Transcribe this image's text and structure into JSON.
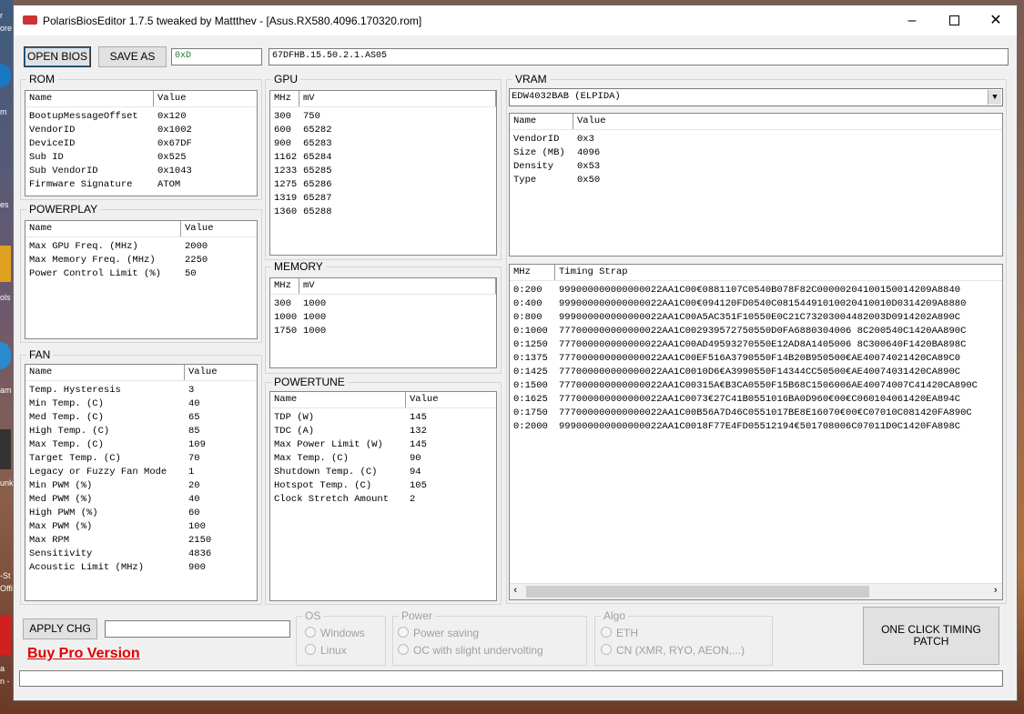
{
  "window": {
    "title": "PolarisBiosEditor 1.7.5 tweaked by Mattthev  - [Asus.RX580.4096.170320.rom]"
  },
  "toolbar": {
    "open_label": "OPEN BIOS",
    "save_label": "SAVE AS",
    "checksum": "0xD",
    "bios_string": "67DFHB.15.50.2.1.AS05"
  },
  "rom": {
    "title": "ROM",
    "headers": [
      "Name",
      "Value"
    ],
    "rows": [
      [
        "BootupMessageOffset",
        "0x120"
      ],
      [
        "VendorID",
        "0x1002"
      ],
      [
        "DeviceID",
        "0x67DF"
      ],
      [
        "Sub ID",
        "0x525"
      ],
      [
        "Sub VendorID",
        "0x1043"
      ],
      [
        "Firmware Signature",
        "ATOM"
      ]
    ]
  },
  "powerplay": {
    "title": "POWERPLAY",
    "headers": [
      "Name",
      "Value"
    ],
    "rows": [
      [
        "Max GPU Freq. (MHz)",
        "2000"
      ],
      [
        "Max Memory Freq. (MHz)",
        "2250"
      ],
      [
        "Power Control Limit (%)",
        "50"
      ]
    ]
  },
  "fan": {
    "title": "FAN",
    "headers": [
      "Name",
      "Value"
    ],
    "rows": [
      [
        "Temp. Hysteresis",
        "3"
      ],
      [
        "Min Temp. (C)",
        "40"
      ],
      [
        "Med Temp. (C)",
        "65"
      ],
      [
        "High Temp. (C)",
        "85"
      ],
      [
        "Max Temp. (C)",
        "109"
      ],
      [
        "Target Temp. (C)",
        "70"
      ],
      [
        "Legacy or Fuzzy Fan Mode",
        "1"
      ],
      [
        "Min PWM (%)",
        "20"
      ],
      [
        "Med PWM (%)",
        "40"
      ],
      [
        "High PWM (%)",
        "60"
      ],
      [
        "Max PWM (%)",
        "100"
      ],
      [
        "Max RPM",
        "2150"
      ],
      [
        "Sensitivity",
        "4836"
      ],
      [
        "Acoustic Limit (MHz)",
        "900"
      ]
    ]
  },
  "gpu": {
    "title": "GPU",
    "headers": [
      "MHz",
      "mV"
    ],
    "rows": [
      [
        "300",
        "750"
      ],
      [
        "600",
        "65282"
      ],
      [
        "900",
        "65283"
      ],
      [
        "1162",
        "65284"
      ],
      [
        "1233",
        "65285"
      ],
      [
        "1275",
        "65286"
      ],
      [
        "1319",
        "65287"
      ],
      [
        "1360",
        "65288"
      ]
    ]
  },
  "memory": {
    "title": "MEMORY",
    "headers": [
      "MHz",
      "mV"
    ],
    "rows": [
      [
        "300",
        "1000"
      ],
      [
        "1000",
        "1000"
      ],
      [
        "1750",
        "1000"
      ]
    ]
  },
  "powertune": {
    "title": "POWERTUNE",
    "headers": [
      "Name",
      "Value"
    ],
    "rows": [
      [
        "TDP (W)",
        "145"
      ],
      [
        "TDC (A)",
        "132"
      ],
      [
        "Max Power Limit (W)",
        "145"
      ],
      [
        "Max Temp. (C)",
        "90"
      ],
      [
        "Shutdown Temp. (C)",
        "94"
      ],
      [
        "Hotspot Temp. (C)",
        "105"
      ],
      [
        "Clock Stretch Amount",
        "2"
      ]
    ]
  },
  "vram": {
    "title": "VRAM",
    "selected": "EDW4032BAB (ELPIDA)",
    "headers": [
      "Name",
      "Value"
    ],
    "rows": [
      [
        "VendorID",
        "0x3"
      ],
      [
        "Size (MB)",
        "4096"
      ],
      [
        "Density",
        "0x53"
      ],
      [
        "Type",
        "0x50"
      ]
    ]
  },
  "timing": {
    "headers": [
      "MHz",
      "Timing Strap"
    ],
    "rows": [
      [
        "0:200",
        "999000000000000022AA1C00€0881107C0540B078F82C0000020410015001420‌9A8840"
      ],
      [
        "0:400",
        "999000000000000022AA1C00€094120FD0540C08154491010020410010D0314209A8880"
      ],
      [
        "0:800",
        "999000000000000022AA1C00A5AC351F10550E0C21C73203004482003D0914202A890C"
      ],
      [
        "0:1000",
        "777000000000000022AA1C002939572750550D0FA6880304006 8C200540C1420AA890C"
      ],
      [
        "0:1250",
        "777000000000000022AA1C00AD49593270550E12AD8A1405006 8C300640F1420BA898C"
      ],
      [
        "0:1375",
        "777000000000000022AA1C00EF516A3790550F14B20B950500€AE40074021420CA89C0"
      ],
      [
        "0:1425",
        "777000000000000022AA1C0010D6€A3990550F14344CC50500€AE40074031420CA890C"
      ],
      [
        "0:1500",
        "777000000000000022AA1C00315A€B3CA0550F15B68C1506006AE40074007C41420CA890C"
      ],
      [
        "0:1625",
        "777000000000000022AA1C0073€27C41B0551016BA0D960€00€C060104061420EA894C"
      ],
      [
        "0:1750",
        "777000000000000022AA1C00B56A7D46C0551017BE8E16070€00€C07010C081420FA890C"
      ],
      [
        "0:2000",
        "999000000000000022AA1C0018F77E4FD05512194€501708006C07011D0C1420FA898C"
      ]
    ]
  },
  "bottom": {
    "apply_label": "APPLY CHG",
    "buy_label": "Buy Pro Version",
    "os": {
      "title": "OS",
      "options": [
        "Windows",
        "Linux"
      ]
    },
    "power": {
      "title": "Power",
      "options": [
        "Power saving",
        "OC with slight undervolting"
      ]
    },
    "algo": {
      "title": "Algo",
      "options": [
        "ETH",
        "CN (XMR, RYO, AEON,...)"
      ]
    },
    "patch_label_1": "ONE CLICK TIMING",
    "patch_label_2": "PATCH"
  },
  "desktop": {
    "labels": [
      "r",
      "ore",
      "m",
      "es",
      "ols",
      "am",
      "unk",
      "-St",
      "Offi",
      "a",
      "n -"
    ]
  }
}
